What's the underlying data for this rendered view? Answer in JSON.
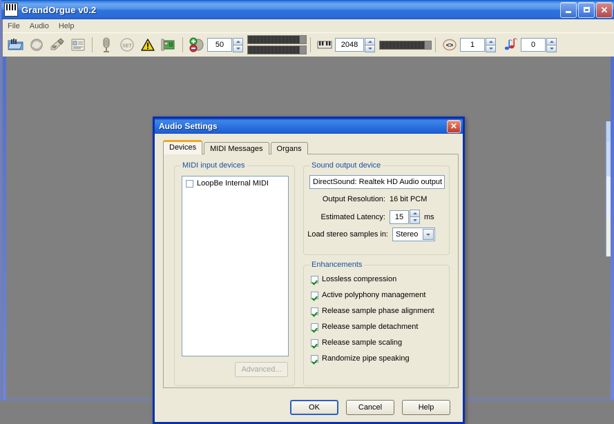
{
  "window": {
    "title": "GrandOrgue v0.2",
    "icon": "organ-keyboard-icon",
    "controls": {
      "minimize": "minimize-icon",
      "maximize": "maximize-icon",
      "close": "close-icon"
    }
  },
  "menubar": {
    "items": [
      "File",
      "Audio",
      "Help"
    ]
  },
  "toolbar": {
    "icons": [
      "open-organ-icon",
      "reload-icon",
      "settings-organ-icon",
      "properties-icon",
      "organ-pipes-icon",
      "set-icon",
      "warning-icon",
      "soundcard-icon",
      "volume-icon"
    ],
    "volume_value": "50",
    "polyphony_icon": "piano-keys-icon",
    "polyphony_value": "2048",
    "transpose_icon": "transpose-icon",
    "transpose_value": "1",
    "memory_icon": "music-note-icon",
    "memory_value": "0"
  },
  "dialog": {
    "title": "Audio Settings",
    "close_label": "✕",
    "tabs": [
      {
        "label": "Devices",
        "active": true
      },
      {
        "label": "MIDI Messages",
        "active": false
      },
      {
        "label": "Organs",
        "active": false
      }
    ],
    "midi_group": {
      "title": "MIDI input devices",
      "devices": [
        {
          "label": "LoopBe Internal MIDI",
          "checked": false
        }
      ],
      "advanced_button": "Advanced...",
      "advanced_enabled": false
    },
    "sound_group": {
      "title": "Sound output device",
      "device_value": "DirectSound: Realtek HD Audio output",
      "resolution_label": "Output Resolution:",
      "resolution_value": "16 bit PCM",
      "latency_label": "Estimated Latency:",
      "latency_value": "15",
      "latency_unit": "ms",
      "stereo_label": "Load stereo samples in:",
      "stereo_value": "Stereo"
    },
    "enhancements_group": {
      "title": "Enhancements",
      "items": [
        {
          "label": "Lossless compression",
          "checked": true
        },
        {
          "label": "Active polyphony management",
          "checked": true
        },
        {
          "label": "Release sample phase alignment",
          "checked": true
        },
        {
          "label": "Release sample detachment",
          "checked": true
        },
        {
          "label": "Release sample scaling",
          "checked": true
        },
        {
          "label": "Randomize pipe speaking",
          "checked": true
        }
      ]
    },
    "buttons": [
      {
        "label": "OK",
        "default": true
      },
      {
        "label": "Cancel",
        "default": false
      },
      {
        "label": "Help",
        "default": false
      }
    ]
  },
  "colors": {
    "title_blue": "#2d74e0",
    "dialog_border": "#0831ae",
    "face": "#ece9d8",
    "group_label": "#1a4fa0",
    "active_tab_accent": "#f2a52c",
    "check_green": "#118a11",
    "desktop": "#808080"
  }
}
